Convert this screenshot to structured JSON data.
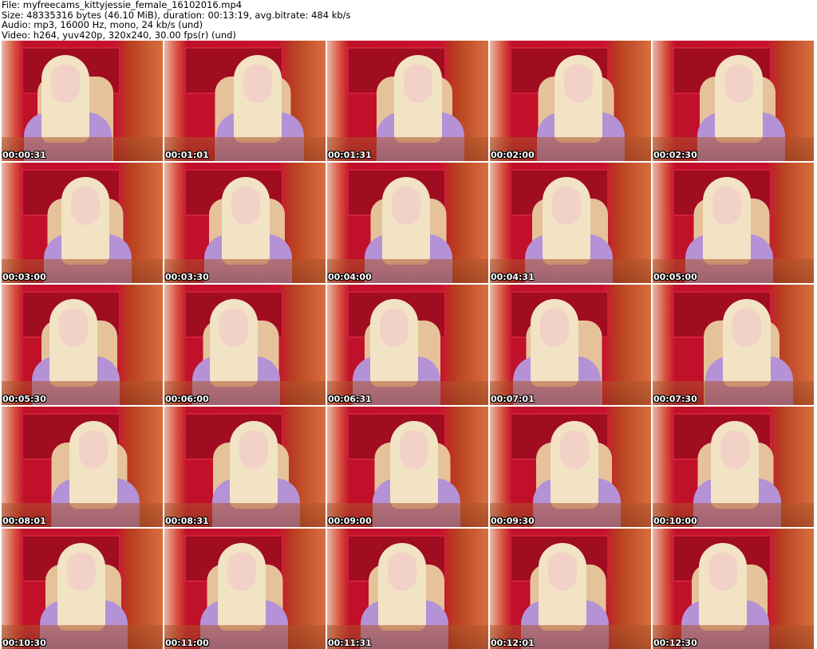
{
  "info": {
    "file": "File: myfreecams_kittyjessie_female_16102016.mp4",
    "size": "Size: 48335316 bytes (46.10 MiB), duration: 00:13:19, avg.bitrate: 484 kb/s",
    "audio": "Audio: mp3, 16000 Hz, mono, 24 kb/s (und)",
    "video": "Video: h264, yuv420p, 320x240, 30.00 fps(r) (und)"
  },
  "thumbnails": [
    "00:00:31",
    "00:01:01",
    "00:01:31",
    "00:02:00",
    "00:02:30",
    "00:03:00",
    "00:03:30",
    "00:04:00",
    "00:04:31",
    "00:05:00",
    "00:05:30",
    "00:06:00",
    "00:06:31",
    "00:07:01",
    "00:07:30",
    "00:08:01",
    "00:08:31",
    "00:09:00",
    "00:09:30",
    "00:10:00",
    "00:10:30",
    "00:11:00",
    "00:11:31",
    "00:12:01",
    "00:12:30"
  ]
}
